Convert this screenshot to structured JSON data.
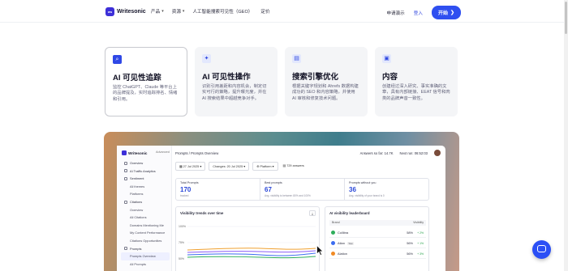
{
  "header": {
    "brand": "Writesonic",
    "nav": [
      {
        "label": "产品",
        "has_menu": true
      },
      {
        "label": "资源",
        "has_menu": true
      },
      {
        "label": "人工智能搜索可见性（GEO）",
        "has_menu": false
      },
      {
        "label": "定价",
        "has_menu": false
      }
    ],
    "demo_label": "申请演示",
    "login_label": "登入",
    "start_label": "开始",
    "start_arrow": "❯"
  },
  "cards": [
    {
      "icon": "search-chart-icon",
      "glyph": "⌕",
      "title": "AI 可见性追踪",
      "desc": "监控 ChatGPT、Claude 等平台上的品牌提及，实时追踪排名、情绪和引用。"
    },
    {
      "icon": "magic-wand-icon",
      "glyph": "✦",
      "title": "AI 可见性操作",
      "desc": "识别引用差距和内容机会，制定切实可行的策略，提升曝光度，并在 AI 搜索结果中超越竞争对手。"
    },
    {
      "icon": "document-search-icon",
      "glyph": "▤",
      "title": "搜索引擎优化",
      "desc": "根据关键字规划和 Ahrefs 数据构建成功的 SEO 和内容策略，并使用 AI 审核和修复技术问题。"
    },
    {
      "icon": "content-icon",
      "glyph": "▣",
      "title": "内容",
      "desc": "创建经过深入研究、事实准确的文章，具有内部链接、EEAT 信号和肉类的品牌声音一致性。"
    }
  ],
  "app": {
    "brand": "Writesonic",
    "plan": "Advanced",
    "sidebar": [
      {
        "label": "Overview",
        "level": 0,
        "selected": false
      },
      {
        "label": "AI Traffic Analytics",
        "level": 0,
        "selected": false
      },
      {
        "label": "Sentiment",
        "level": 0,
        "selected": false
      },
      {
        "label": "All themes",
        "level": 1,
        "selected": false
      },
      {
        "label": "Platforms",
        "level": 1,
        "selected": false
      },
      {
        "label": "Citations",
        "level": 0,
        "selected": false
      },
      {
        "label": "Overview",
        "level": 1,
        "selected": false
      },
      {
        "label": "All Citations",
        "level": 1,
        "selected": false
      },
      {
        "label": "Domains Mentioning Me",
        "level": 1,
        "selected": false
      },
      {
        "label": "My Content Performance",
        "level": 1,
        "selected": false
      },
      {
        "label": "Citations Opportunities",
        "level": 1,
        "selected": false
      },
      {
        "label": "Prompts",
        "level": 0,
        "selected": false
      },
      {
        "label": "Prompts Overview",
        "level": 1,
        "selected": true
      },
      {
        "label": "All Prompts",
        "level": 1,
        "selected": false
      }
    ],
    "breadcrumb": "Prompts / Prompts Overview",
    "answers_label": "Answers so far: 14.7K",
    "next_run_label": "Next run: 06:52:03",
    "filters": {
      "date": "27 Jul 2025",
      "changes": "Changes: 20 Jul 2025",
      "platform": "Platform",
      "answers": "729 answers"
    },
    "stats": [
      {
        "label": "Total Prompts",
        "value": "170",
        "note": "tracked"
      },
      {
        "label": "Best prompts",
        "value": "67",
        "note": "Avg. visibility is between 80% and 100%"
      },
      {
        "label": "Prompts without you",
        "value": "36",
        "note": "Avg. visibility of your brand is 0"
      }
    ],
    "trend": {
      "title": "Visibility trends over time",
      "yticks": [
        "100%",
        "75%",
        "50%"
      ]
    },
    "leaderboard": {
      "title": "AI visibility leaderboard",
      "col_brand": "Brand",
      "col_visibility": "Visibility",
      "rows": [
        {
          "brand": "Collibra",
          "tag": "",
          "visibility": "58%",
          "delta": "+ 2%",
          "color": "#2fae5c"
        },
        {
          "brand": "Atlan",
          "tag": "You",
          "visibility": "56%",
          "delta": "+ 1%",
          "color": "#3b6cf0"
        },
        {
          "brand": "Alation",
          "tag": "",
          "visibility": "56%",
          "delta": "+ 3%",
          "color": "#f08a24"
        }
      ]
    }
  },
  "colors": {
    "accent": "#2f4ff0",
    "brand": "#3d2fd8",
    "chart_lines": [
      "#f0a030",
      "#8b5cf6",
      "#3b6cf0",
      "#2fae5c"
    ]
  }
}
